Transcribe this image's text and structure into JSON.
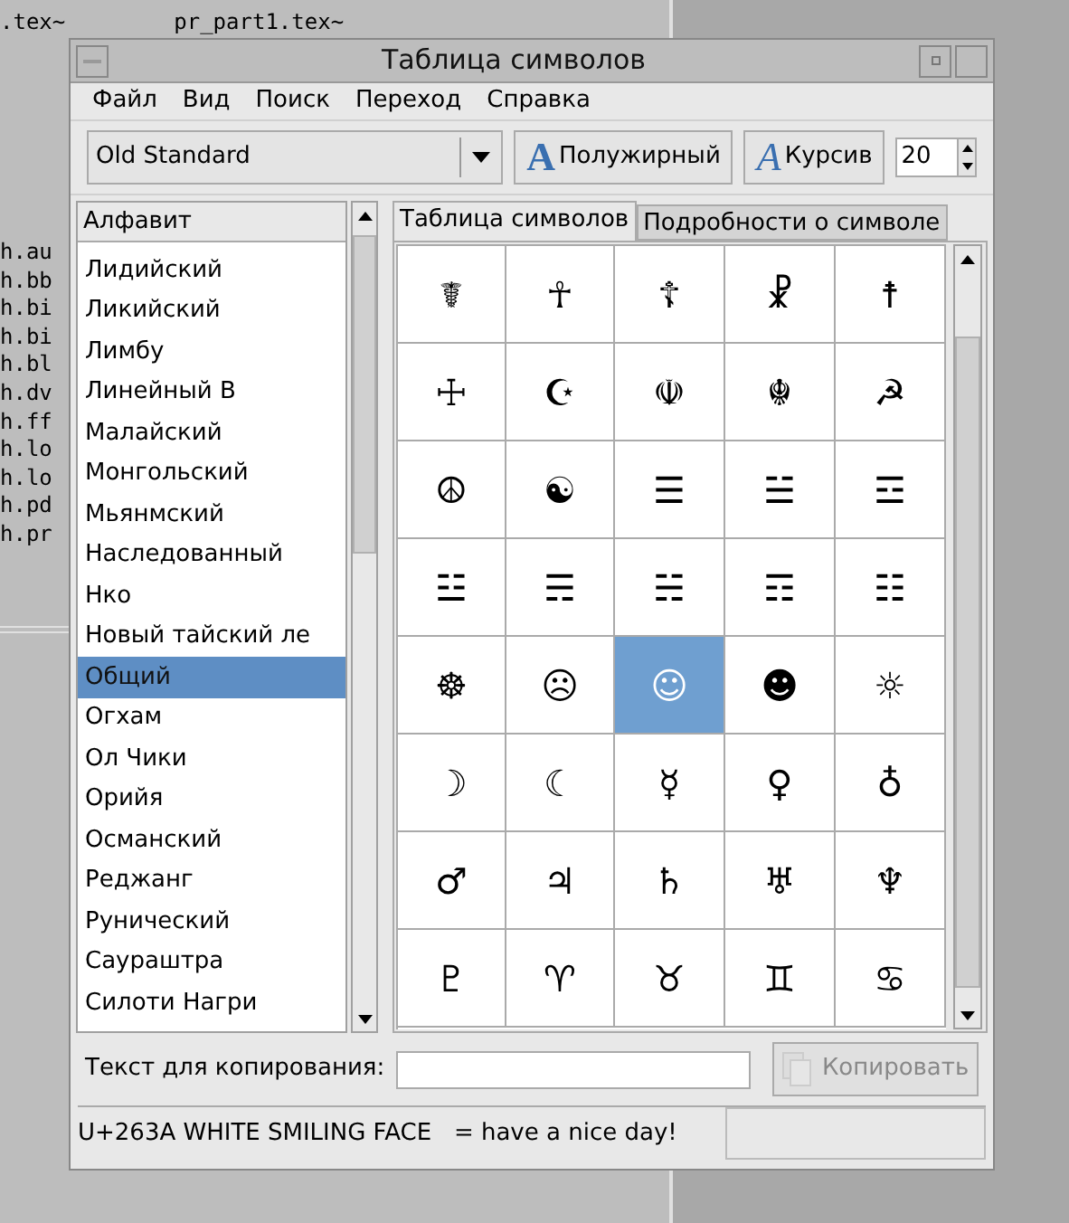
{
  "terminal": {
    "lines": [
      ".tex~",
      "pr_part1.tex~"
    ],
    "files": [
      "h.au",
      "h.bb",
      "h.bi",
      "h.bi",
      "h.bl",
      "h.dv",
      "h.ff",
      "h.lo",
      "h.lo",
      "h.pd",
      "h.pr"
    ]
  },
  "window": {
    "title": "Таблица символов"
  },
  "menu": [
    {
      "label": "Файл"
    },
    {
      "label": "Вид"
    },
    {
      "label": "Поиск"
    },
    {
      "label": "Переход"
    },
    {
      "label": "Справка"
    }
  ],
  "toolbar": {
    "font": "Old Standard",
    "bold": {
      "icon": "A",
      "label": "Полужирный",
      "selected": false
    },
    "italic": {
      "icon": "A",
      "label": "Курсив",
      "selected": false
    },
    "size": "20"
  },
  "sidebar": {
    "header": "Алфавит",
    "items": [
      {
        "label": "Лидийский",
        "selected": false
      },
      {
        "label": "Ликийский",
        "selected": false
      },
      {
        "label": "Лимбу",
        "selected": false
      },
      {
        "label": "Линейный В",
        "selected": false
      },
      {
        "label": "Малайский",
        "selected": false
      },
      {
        "label": "Монгольский",
        "selected": false
      },
      {
        "label": "Мьянмский",
        "selected": false
      },
      {
        "label": "Наследованный",
        "selected": false
      },
      {
        "label": "Нко",
        "selected": false
      },
      {
        "label": "Новый тайский ле",
        "selected": false
      },
      {
        "label": "Общий",
        "selected": true
      },
      {
        "label": "Огхам",
        "selected": false
      },
      {
        "label": "Ол Чики",
        "selected": false
      },
      {
        "label": "Орийя",
        "selected": false
      },
      {
        "label": "Османский",
        "selected": false
      },
      {
        "label": "Реджанг",
        "selected": false
      },
      {
        "label": "Рунический",
        "selected": false
      },
      {
        "label": "Саураштра",
        "selected": false
      },
      {
        "label": "Силоти Нагри",
        "selected": false
      }
    ]
  },
  "tabs": [
    {
      "label": "Таблица символов",
      "selected": true
    },
    {
      "label": "Подробности о символе",
      "selected": false
    }
  ],
  "grid": [
    {
      "char": "☤",
      "selected": false
    },
    {
      "char": "☥",
      "selected": false
    },
    {
      "char": "☦",
      "selected": false
    },
    {
      "char": "☧",
      "selected": false
    },
    {
      "char": "☨",
      "selected": false
    },
    {
      "char": "☩",
      "selected": false
    },
    {
      "char": "☪",
      "selected": false
    },
    {
      "char": "☫",
      "selected": false
    },
    {
      "char": "☬",
      "selected": false
    },
    {
      "char": "☭",
      "selected": false
    },
    {
      "char": "☮",
      "selected": false
    },
    {
      "char": "☯",
      "selected": false
    },
    {
      "char": "☰",
      "selected": false
    },
    {
      "char": "☱",
      "selected": false
    },
    {
      "char": "☲",
      "selected": false
    },
    {
      "char": "☳",
      "selected": false
    },
    {
      "char": "☴",
      "selected": false
    },
    {
      "char": "☵",
      "selected": false
    },
    {
      "char": "☶",
      "selected": false
    },
    {
      "char": "☷",
      "selected": false
    },
    {
      "char": "☸",
      "selected": false
    },
    {
      "char": "☹",
      "selected": false
    },
    {
      "char": "☺",
      "selected": true
    },
    {
      "char": "☻",
      "selected": false
    },
    {
      "char": "☼",
      "selected": false
    },
    {
      "char": "☽",
      "selected": false
    },
    {
      "char": "☾",
      "selected": false
    },
    {
      "char": "☿",
      "selected": false
    },
    {
      "char": "♀",
      "selected": false
    },
    {
      "char": "♁",
      "selected": false
    },
    {
      "char": "♂",
      "selected": false
    },
    {
      "char": "♃",
      "selected": false
    },
    {
      "char": "♄",
      "selected": false
    },
    {
      "char": "♅",
      "selected": false
    },
    {
      "char": "♆",
      "selected": false
    },
    {
      "char": "♇",
      "selected": false
    },
    {
      "char": "♈",
      "selected": false
    },
    {
      "char": "♉",
      "selected": false
    },
    {
      "char": "♊",
      "selected": false
    },
    {
      "char": "♋",
      "selected": false
    }
  ],
  "copy": {
    "label": "Текст для копирования:",
    "button": {
      "label": "Копировать",
      "disabled": true
    }
  },
  "status_bar": {
    "text": "U+263A WHITE SMILING FACE   = have a nice day!"
  }
}
